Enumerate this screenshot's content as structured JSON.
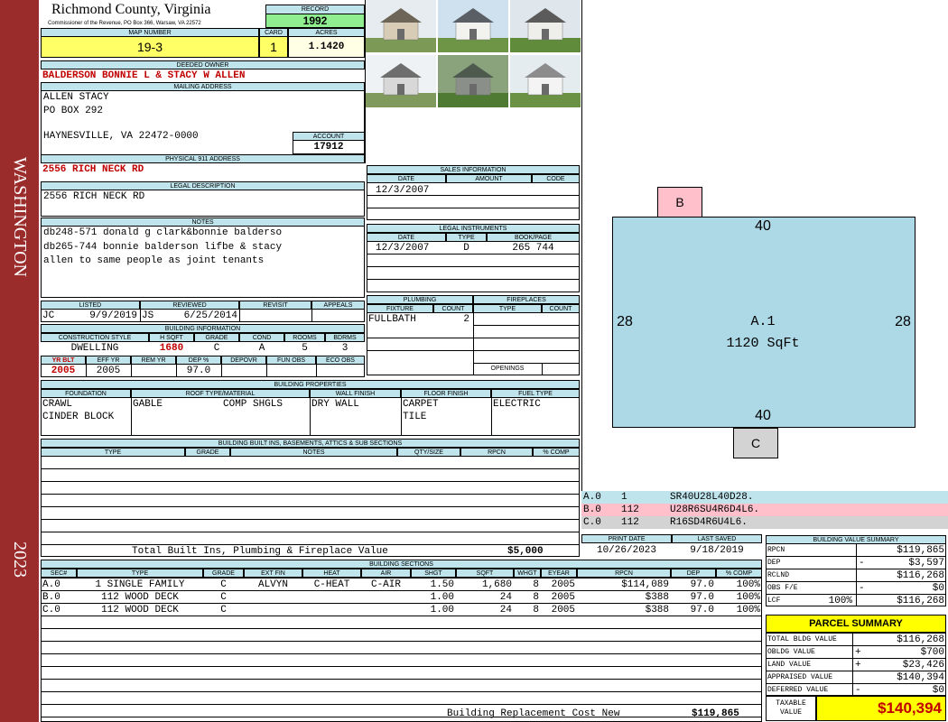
{
  "side": {
    "district": "WASHINGTON",
    "year": "2023"
  },
  "header": {
    "county": "Richmond County, Virginia",
    "commissioner": "Commissioner of the Revenue, PO Box 366, Warsaw, VA 22572",
    "record_label": "RECORD",
    "record": "1992",
    "map_number_label": "MAP NUMBER",
    "map_number": "19-3",
    "card_label": "CARD",
    "card": "1",
    "acres_label": "ACRES",
    "acres": "1.1420"
  },
  "owner": {
    "deeded_label": "DEEDED OWNER",
    "deeded_owner": "BALDERSON BONNIE L & STACY W ALLEN",
    "mailing_label": "MAILING ADDRESS",
    "line1": "ALLEN STACY",
    "line2": "PO BOX 292",
    "line3": "HAYNESVILLE, VA 22472-0000",
    "account_label": "ACCOUNT",
    "account": "17912",
    "physical_label": "PHYSICAL 911 ADDRESS",
    "physical": "2556 RICH NECK RD",
    "legal_label": "LEGAL DESCRIPTION",
    "legal": "2556 RICH NECK RD"
  },
  "notes": {
    "label": "NOTES",
    "line1": "db248-571 donald g clark&bonnie balderso",
    "line2": "db265-744 bonnie balderson lifbe & stacy",
    "line3": "allen to same people as joint tenants"
  },
  "status": {
    "listed_label": "LISTED",
    "reviewed_label": "REVIEWED",
    "revisit_label": "REVISIT",
    "appeals_label": "APPEALS",
    "listed_by": "JC",
    "listed_date": "9/9/2019",
    "reviewed_by": "JS",
    "reviewed_date": "6/25/2014"
  },
  "building_info": {
    "label": "BUILDING INFORMATION",
    "h1": "CONSTRUCTION STYLE",
    "h2": "H SQFT",
    "h3": "GRADE",
    "h4": "COND",
    "h5": "ROOMS",
    "h6": "BDRMS",
    "style": "DWELLING",
    "sqft": "1680",
    "grade": "C",
    "cond": "A",
    "rooms": "5",
    "bdrms": "3",
    "h7": "YR BLT",
    "h8": "EFF YR",
    "h9": "REM YR",
    "h10": "DEP %",
    "h11": "DEPOVR",
    "h12": "FUN OBS",
    "h13": "ECO OBS",
    "yr_blt": "2005",
    "eff_yr": "2005",
    "dep": "97.0"
  },
  "sales": {
    "label": "SALES INFORMATION",
    "h_date": "DATE",
    "h_amount": "AMOUNT",
    "h_code": "CODE",
    "date": "12/3/2007"
  },
  "legal_instruments": {
    "label": "LEGAL INSTRUMENTS",
    "h_date": "DATE",
    "h_type": "TYPE",
    "h_book": "BOOK/PAGE",
    "date": "12/3/2007",
    "type": "D",
    "book": "265 744"
  },
  "plumbing": {
    "label": "PLUMBING",
    "h_fixture": "FIXTURE",
    "h_count": "COUNT",
    "fixture": "FULLBATH",
    "count": "2"
  },
  "fireplaces": {
    "label": "FIREPLACES",
    "h_type": "TYPE",
    "h_count": "COUNT",
    "openings": "OPENINGS"
  },
  "properties": {
    "label": "BUILDING PROPERTIES",
    "h1": "FOUNDATION",
    "h2": "ROOF TYPE/MATERIAL",
    "h3": "WALL FINISH",
    "h4": "FLOOR FINISH",
    "h5": "FUEL TYPE",
    "found1": "CRAWL",
    "found2": "CINDER BLOCK",
    "roof_type": "GABLE",
    "roof_mat": "COMP SHGLS",
    "wall": "DRY WALL",
    "floor1": "CARPET",
    "floor2": "TILE",
    "fuel": "ELECTRIC"
  },
  "builtins": {
    "label": "BUILDING BUILT INS, BASEMENTS, ATTICS & SUB SECTIONS",
    "h1": "TYPE",
    "h2": "GRADE",
    "h3": "NOTES",
    "h4": "QTY/SIZE",
    "h5": "RPCN",
    "h6": "% COMP",
    "total_label": "Total Built Ins, Plumbing & Fireplace Value",
    "total": "$5,000"
  },
  "sketch": {
    "b": "B",
    "c": "C",
    "top": "40",
    "bottom": "40",
    "left": "28",
    "right": "28",
    "area_name": "A.1",
    "area_size": "1120 SqFt"
  },
  "legend": [
    {
      "a": "A.0",
      "b": "1",
      "c": "SR40U28L40D28.",
      "color": "#bfe4ec"
    },
    {
      "a": "B.0",
      "b": "112",
      "c": "U28R6SU4R6D4L6.",
      "color": "#ffc0cb"
    },
    {
      "a": "C.0",
      "b": "112",
      "c": "R16SD4R6U4L6.",
      "color": "#d3d3d3"
    }
  ],
  "dates": {
    "print_label": "PRINT DATE",
    "saved_label": "LAST SAVED",
    "print": "10/26/2023",
    "saved": "9/18/2019"
  },
  "sections": {
    "label": "BUILDING SECTIONS",
    "headers": [
      "SEC#",
      "TYPE",
      "GRADE",
      "EXT FIN",
      "HEAT",
      "AIR",
      "SHGT",
      "SQFT",
      "WHGT",
      "EYEAR",
      "RPCN",
      "DEP",
      "% COMP"
    ],
    "rows": [
      {
        "sec": "A.0",
        "type": "1 SINGLE FAMILY",
        "grade": "C",
        "ext": "ALVYN",
        "heat": "C-HEAT",
        "air": "C-AIR",
        "shgt": "1.50",
        "sqft": "1,680",
        "whgt": "8",
        "eyear": "2005",
        "rpcn": "$114,089",
        "dep": "97.0",
        "comp": "100%"
      },
      {
        "sec": "B.0",
        "type": "112 WOOD DECK",
        "grade": "C",
        "ext": "",
        "heat": "",
        "air": "",
        "shgt": "1.00",
        "sqft": "24",
        "whgt": "8",
        "eyear": "2005",
        "rpcn": "$388",
        "dep": "97.0",
        "comp": "100%"
      },
      {
        "sec": "C.0",
        "type": "112 WOOD DECK",
        "grade": "C",
        "ext": "",
        "heat": "",
        "air": "",
        "shgt": "1.00",
        "sqft": "24",
        "whgt": "8",
        "eyear": "2005",
        "rpcn": "$388",
        "dep": "97.0",
        "comp": "100%"
      }
    ],
    "replacement_label": "Building Replacement Cost New",
    "replacement": "$119,865"
  },
  "value_summary": {
    "label": "BUILDING VALUE SUMMARY",
    "rpcn_l": "RPCN",
    "rpcn": "$119,865",
    "dep_l": "DEP",
    "dep_sign": "-",
    "dep": "$3,597",
    "rclnd_l": "RCLND",
    "rclnd": "$116,268",
    "obs_l": "OBS F/E",
    "obs_sign": "-",
    "obs": "$0",
    "lcf_l": "LCF",
    "lcf_pct": "100%",
    "lcf": "$116,268"
  },
  "parcel": {
    "label": "PARCEL SUMMARY",
    "bldg_l": "TOTAL BLDG VALUE",
    "bldg": "$116,268",
    "obldg_l": "OBLDG VALUE",
    "obldg_sign": "+",
    "obldg": "$700",
    "land_l": "LAND VALUE",
    "land_sign": "+",
    "land": "$23,426",
    "appr_l": "APPRAISED VALUE",
    "appr": "$140,394",
    "def_l": "DEFERRED VALUE",
    "def_sign": "-",
    "def": "$0",
    "tax_l1": "TAXABLE",
    "tax_l2": "VALUE",
    "tax": "$140,394"
  },
  "photos": [
    {
      "name": "shed-photo",
      "wall": "#d9ccb6",
      "roof": "#6d6558",
      "sky": "#e6ecef",
      "grass": "#7c9a56"
    },
    {
      "name": "house-front-photo",
      "wall": "#f2f2ef",
      "roof": "#5a5f66",
      "sky": "#cfe0ee",
      "grass": "#6e9446"
    },
    {
      "name": "house-side-photo",
      "wall": "#eeeeea",
      "roof": "#5b5b5b",
      "sky": "#dfe7ec",
      "grass": "#5f8b3b"
    },
    {
      "name": "house-gable-photo",
      "wall": "#d8d8d8",
      "roof": "#6e6e6e",
      "sky": "#eef2f5",
      "grass": "#7f9a5c"
    },
    {
      "name": "address-post-photo",
      "wall": "#8a8f8a",
      "roof": "#4f5a4f",
      "sky": "#8aa37c",
      "grass": "#4f7a33"
    },
    {
      "name": "outbuilding-photo",
      "wall": "#f4f4f4",
      "roof": "#8c8c8c",
      "sky": "#e5ecef",
      "grass": "#6b9144"
    }
  ]
}
